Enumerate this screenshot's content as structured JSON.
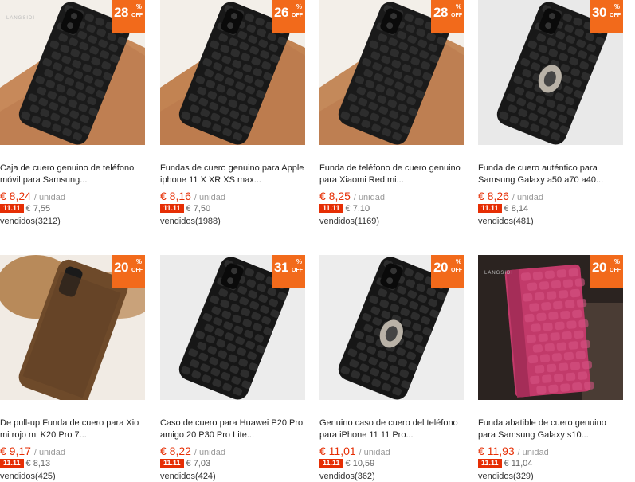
{
  "products": [
    {
      "discount": "28",
      "off_label": "OFF",
      "pct_symbol": "%",
      "title": "Caja de cuero genuino de teléfono móvil para Samsung...",
      "price": "€ 8,24",
      "unit": "/ unidad",
      "promo_tag": "11.11",
      "promo_price": "€ 7,55",
      "sold": "vendidos(3212)",
      "image": "black-croc-phone-case",
      "brand_mark": "LANGSIDI",
      "colors": {
        "bg": "#c7895a",
        "case": "#1a1a1a"
      }
    },
    {
      "discount": "26",
      "off_label": "OFF",
      "pct_symbol": "%",
      "title": "Fundas de cuero genuino para Apple iphone 11 X XR XS max...",
      "price": "€ 8,16",
      "unit": "/ unidad",
      "promo_tag": "11.11",
      "promo_price": "€ 7,50",
      "sold": "vendidos(1988)",
      "image": "black-croc-iphone-case",
      "brand_mark": "",
      "colors": {
        "bg": "#c28352",
        "case": "#181818"
      }
    },
    {
      "discount": "28",
      "off_label": "OFF",
      "pct_symbol": "%",
      "title": "Funda de teléfono de cuero genuino para Xiaomi Red mi...",
      "price": "€ 8,25",
      "unit": "/ unidad",
      "promo_tag": "11.11",
      "promo_price": "€ 7,10",
      "sold": "vendidos(1169)",
      "image": "black-croc-xiaomi-case",
      "brand_mark": "",
      "colors": {
        "bg": "#c4895a",
        "case": "#1a1a1a"
      }
    },
    {
      "discount": "30",
      "off_label": "OFF",
      "pct_symbol": "%",
      "title": "Funda de cuero auténtico para Samsung Galaxy a50 a70 a40...",
      "price": "€ 8,26",
      "unit": "/ unidad",
      "promo_tag": "11.11",
      "promo_price": "€ 8,14",
      "sold": "vendidos(481)",
      "image": "black-croc-ring-case",
      "brand_mark": "",
      "colors": {
        "bg": "#e9e9e9",
        "case": "#181818"
      }
    },
    {
      "discount": "20",
      "off_label": "OFF",
      "pct_symbol": "%",
      "title": "De pull-up Funda de cuero para Xio mi rojo mi K20 Pro 7...",
      "price": "€ 9,17",
      "unit": "/ unidad",
      "promo_tag": "11.11",
      "promo_price": "€ 8,13",
      "sold": "vendidos(425)",
      "image": "brown-leather-case",
      "brand_mark": "",
      "colors": {
        "bg": "#9c6b4a",
        "case": "#6e4a2a"
      }
    },
    {
      "discount": "31",
      "off_label": "OFF",
      "pct_symbol": "%",
      "title": "Caso de cuero para Huawei P20 Pro amigo 20 P30 Pro Lite...",
      "price": "€ 8,22",
      "unit": "/ unidad",
      "promo_tag": "11.11",
      "promo_price": "€ 7,03",
      "sold": "vendidos(424)",
      "image": "black-croc-huawei-case",
      "brand_mark": "",
      "colors": {
        "bg": "#ececec",
        "case": "#161616"
      }
    },
    {
      "discount": "20",
      "off_label": "OFF",
      "pct_symbol": "%",
      "title": "Genuino caso de cuero del teléfono para iPhone 11 11 Pro...",
      "price": "€ 11,01",
      "unit": "/ unidad",
      "promo_tag": "11.11",
      "promo_price": "€ 10,59",
      "sold": "vendidos(362)",
      "image": "black-croc-iphone-ring-case",
      "brand_mark": "",
      "colors": {
        "bg": "#ededed",
        "case": "#161616"
      }
    },
    {
      "discount": "20",
      "off_label": "OFF",
      "pct_symbol": "%",
      "title": "Funda abatible de cuero genuino para Samsung Galaxy s10...",
      "price": "€ 11,93",
      "unit": "/ unidad",
      "promo_tag": "11.11",
      "promo_price": "€ 11,04",
      "sold": "vendidos(329)",
      "image": "pink-croc-flip-case",
      "brand_mark": "LANGSIDI",
      "colors": {
        "bg": "#2b2320",
        "case": "#c23a6a"
      }
    }
  ]
}
